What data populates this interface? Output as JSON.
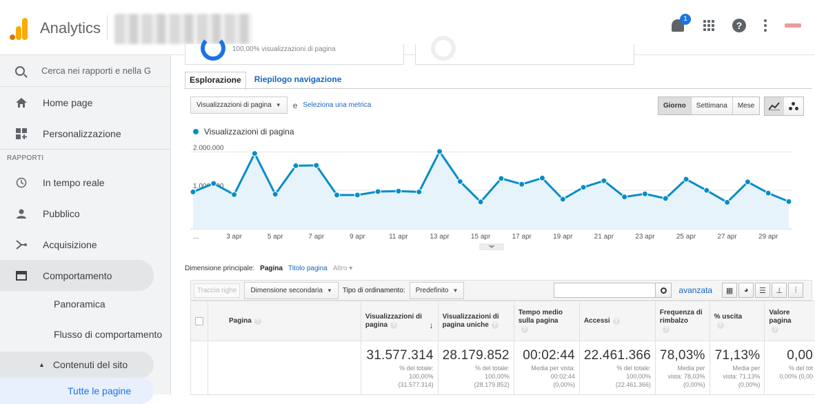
{
  "header": {
    "app_title": "Analytics",
    "notification_count": "1",
    "brand_colors": {
      "orange": "#f9ab00",
      "dark_orange": "#e37400",
      "accent_blue": "#1a73e8"
    }
  },
  "sidebar": {
    "search_placeholder": "Cerca nei rapporti e nella G",
    "items_top": [
      {
        "label": "Home page",
        "icon": "home-icon"
      },
      {
        "label": "Personalizzazione",
        "icon": "dashboard-plus-icon"
      }
    ],
    "section_label": "RAPPORTI",
    "items_reports": [
      {
        "label": "In tempo reale",
        "icon": "clock-icon"
      },
      {
        "label": "Pubblico",
        "icon": "person-icon"
      },
      {
        "label": "Acquisizione",
        "icon": "acquisition-icon"
      },
      {
        "label": "Comportamento",
        "icon": "window-icon"
      }
    ],
    "sub_items": {
      "overview": "Panoramica",
      "flow": "Flusso di comportamento",
      "site_content": "Contenuti del sito",
      "all_pages": "Tutte le pagine"
    }
  },
  "summary": {
    "card_caption": "100,00% visualizzazioni di pagina"
  },
  "tabs": [
    {
      "label": "Esplorazione",
      "selected": true
    },
    {
      "label": "Riepilogo navigazione",
      "selected": false
    }
  ],
  "controls": {
    "metric_select": "Visualizzazioni di pagina",
    "conjunction": "e",
    "select_metric_link": "Seleziona una metrica",
    "periods": [
      "Giorno",
      "Settimana",
      "Mese"
    ],
    "active_period": "Giorno"
  },
  "chart_data": {
    "type": "area",
    "series": [
      {
        "name": "Visualizzazioni di pagina",
        "color": "#058dc7",
        "values": [
          960000,
          1180000,
          890000,
          1960000,
          900000,
          1640000,
          1650000,
          880000,
          880000,
          970000,
          980000,
          960000,
          2010000,
          1230000,
          700000,
          1310000,
          1160000,
          1320000,
          770000,
          1080000,
          1250000,
          830000,
          910000,
          790000,
          1290000,
          1000000,
          690000,
          1220000,
          930000,
          710000
        ]
      }
    ],
    "x_tick_labels": [
      "...",
      "3 apr",
      "5 apr",
      "7 apr",
      "9 apr",
      "11 apr",
      "13 apr",
      "15 apr",
      "17 apr",
      "19 apr",
      "21 apr",
      "23 apr",
      "25 apr",
      "27 apr",
      "29 apr"
    ],
    "y_tick_labels": [
      "2.000.000",
      "1.000.000"
    ],
    "y_ticks": [
      2000000,
      1000000
    ],
    "ylim": [
      0,
      2400000
    ],
    "grid": true,
    "legend": "top-left"
  },
  "dimension": {
    "label": "Dimensione principale:",
    "active": "Pagina",
    "alt": "Titolo pagina",
    "more": "Altro ▾"
  },
  "toolbar": {
    "plot_rows": "Traccia righe",
    "secondary_dimension": "Dimensione secondaria",
    "sort_type_label": "Tipo di ordinamento:",
    "sort_type_value": "Predefinito",
    "advanced_link": "avanzata"
  },
  "table": {
    "headers": [
      "Pagina",
      "Visualizzazioni di pagina",
      "Visualizzazioni di pagina uniche",
      "Tempo medio sulla pagina",
      "Accessi",
      "Frequenza di rimbalzo",
      "% uscita",
      "Valore pagina"
    ],
    "totals": [
      {
        "value": "31.577.314",
        "line1": "% del totale:",
        "line2": "100,00%",
        "line3": "(31.577.314)"
      },
      {
        "value": "28.179.852",
        "line1": "% del totale:",
        "line2": "100,00%",
        "line3": "(28.179.852)"
      },
      {
        "value": "00:02:44",
        "line1": "Media per vista:",
        "line2": "00:02:44",
        "line3": "(0,00%)"
      },
      {
        "value": "22.461.366",
        "line1": "% del totale:",
        "line2": "100,00%",
        "line3": "(22.461.366)"
      },
      {
        "value": "78,03%",
        "line1": "Media per",
        "line2": "vista: 78,03%",
        "line3": "(0,00%)"
      },
      {
        "value": "71,13%",
        "line1": "Media per",
        "line2": "vista: 71,13%",
        "line3": "(0,00%)"
      },
      {
        "value": "0,00",
        "line1": "% del tot",
        "line2": "0,00% (0,00",
        "line3": ""
      }
    ]
  }
}
